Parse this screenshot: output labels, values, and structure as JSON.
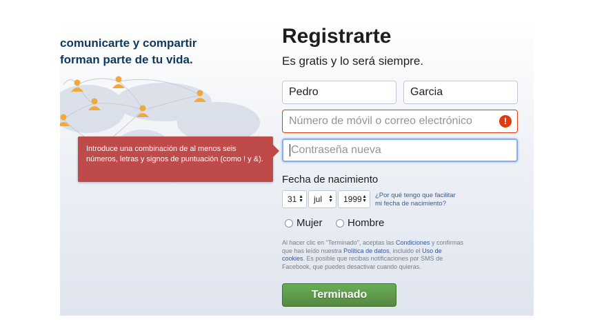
{
  "tagline": {
    "line1": "comunicarte y compartir",
    "line2": "forman parte de tu vida."
  },
  "signup": {
    "title": "Registrarte",
    "subtitle": "Es gratis y lo será siempre.",
    "first_name_value": "Pedro",
    "last_name_value": "Garcia",
    "mobile_placeholder": "Número de móvil o correo electrónico",
    "password_placeholder": "Contraseña nueva",
    "warning_icon": "!"
  },
  "tooltip": {
    "text": "Introduce una combinación de al menos seis números, letras y signos de puntuación (como ! y &)."
  },
  "birthday": {
    "label": "Fecha de nacimiento",
    "day": "31",
    "month": "jul",
    "year": "1999",
    "why_line1": "¿Por qué tengo que facilitar",
    "why_line2": "mi fecha de nacimiento?"
  },
  "gender": {
    "female": "Mujer",
    "male": "Hombre"
  },
  "legal": {
    "t1": "Al hacer clic en \"Terminado\", aceptas las ",
    "conditions_link": "Condiciones",
    "t2": " y confirmas que has leído nuestra ",
    "data_policy_link": "Política de datos",
    "t3": ", incluido el ",
    "cookies_link": "Uso de cookies",
    "t4": ". Es posible que recibas notificaciones por SMS de Facebook, que puedes desactivar cuando quieras."
  },
  "submit_label": "Terminado",
  "colors": {
    "error_red": "#dd3c10",
    "tooltip_red": "#be4b49",
    "button_green": "#67ae55",
    "link_blue": "#365899",
    "tagline_blue": "#0e385f",
    "person_icon": "#f0a93b"
  }
}
